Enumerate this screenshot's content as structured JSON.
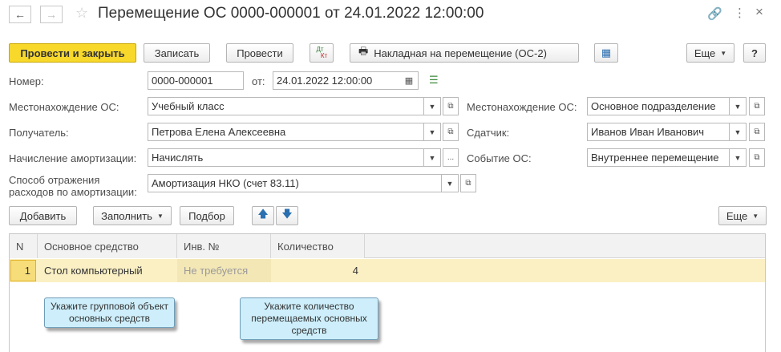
{
  "window": {
    "title": "Перемещение ОС 0000-000001 от 24.01.2022 12:00:00"
  },
  "toolbar": {
    "post_close": "Провести и закрыть",
    "save": "Записать",
    "post": "Провести",
    "dtkt_top": "Дт",
    "dtkt_bottom": "Кт",
    "print_os2": "Накладная на перемещение (ОС-2)",
    "more": "Еще",
    "help": "?"
  },
  "form": {
    "number_label": "Номер:",
    "number_value": "0000-000001",
    "date_label": "от:",
    "date_value": "24.01.2022 12:00:00",
    "location_label": "Местонахождение ОС:",
    "location_value": "Учебный класс",
    "location2_label": "Местонахождение ОС:",
    "location2_value": "Основное подразделение",
    "recipient_label": "Получатель:",
    "recipient_value": "Петрова Елена Алексеевна",
    "sender_label": "Сдатчик:",
    "sender_value": "Иванов Иван Иванович",
    "depreciation_label": "Начисление амортизации:",
    "depreciation_value": "Начислять",
    "event_label": "Событие ОС:",
    "event_value": "Внутреннее перемещение",
    "expense_label_line1": "Способ отражения",
    "expense_label_line2": "расходов по амортизации:",
    "expense_value": "Амортизация НКО (счет 83.11)"
  },
  "table_toolbar": {
    "add": "Добавить",
    "fill": "Заполнить",
    "select": "Подбор",
    "more": "Еще"
  },
  "table": {
    "columns": [
      "N",
      "Основное средство",
      "Инв. №",
      "Количество"
    ],
    "rows": [
      {
        "n": "1",
        "asset": "Стол компьютерный",
        "inv": "Не требуется",
        "qty": "4"
      }
    ]
  },
  "tooltips": {
    "group_object": "Укажите групповой объект основных средств",
    "quantity": "Укажите количество перемещаемых основных средств"
  },
  "colors": {
    "primary_button": "#f7d82b",
    "selected_row": "#fbf0c4",
    "tooltip_bg": "#cdeefa"
  }
}
